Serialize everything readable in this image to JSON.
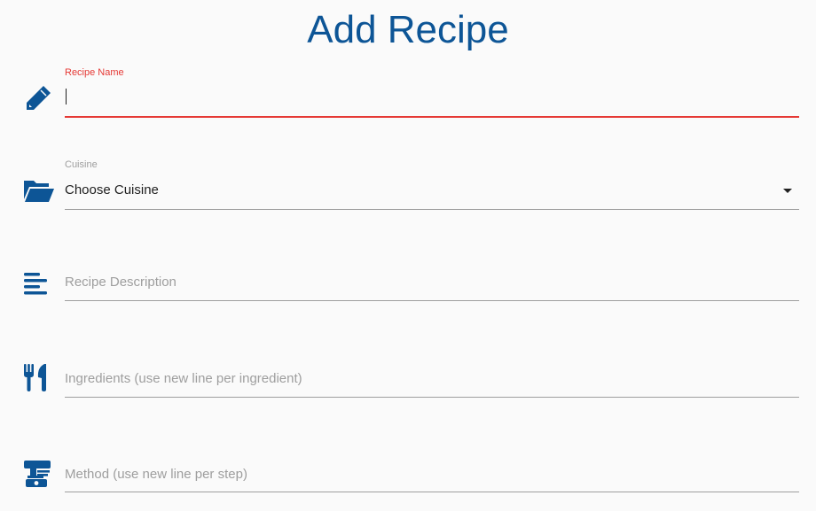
{
  "page": {
    "title": "Add Recipe"
  },
  "form": {
    "recipe_name": {
      "label": "Recipe Name",
      "value": "",
      "icon": "pencil-icon"
    },
    "cuisine": {
      "label": "Cuisine",
      "selected": "Choose Cuisine",
      "icon": "folder-open-icon"
    },
    "description": {
      "placeholder": "Recipe Description",
      "icon": "align-left-icon"
    },
    "ingredients": {
      "placeholder": "Ingredients (use new line per ingredient)",
      "icon": "utensils-icon"
    },
    "method": {
      "placeholder": "Method (use new line per step)",
      "icon": "mixer-icon"
    }
  },
  "colors": {
    "accent": "#0d5596",
    "active": "#e53935",
    "muted": "#9e9e9e",
    "background": "#fafafa"
  }
}
